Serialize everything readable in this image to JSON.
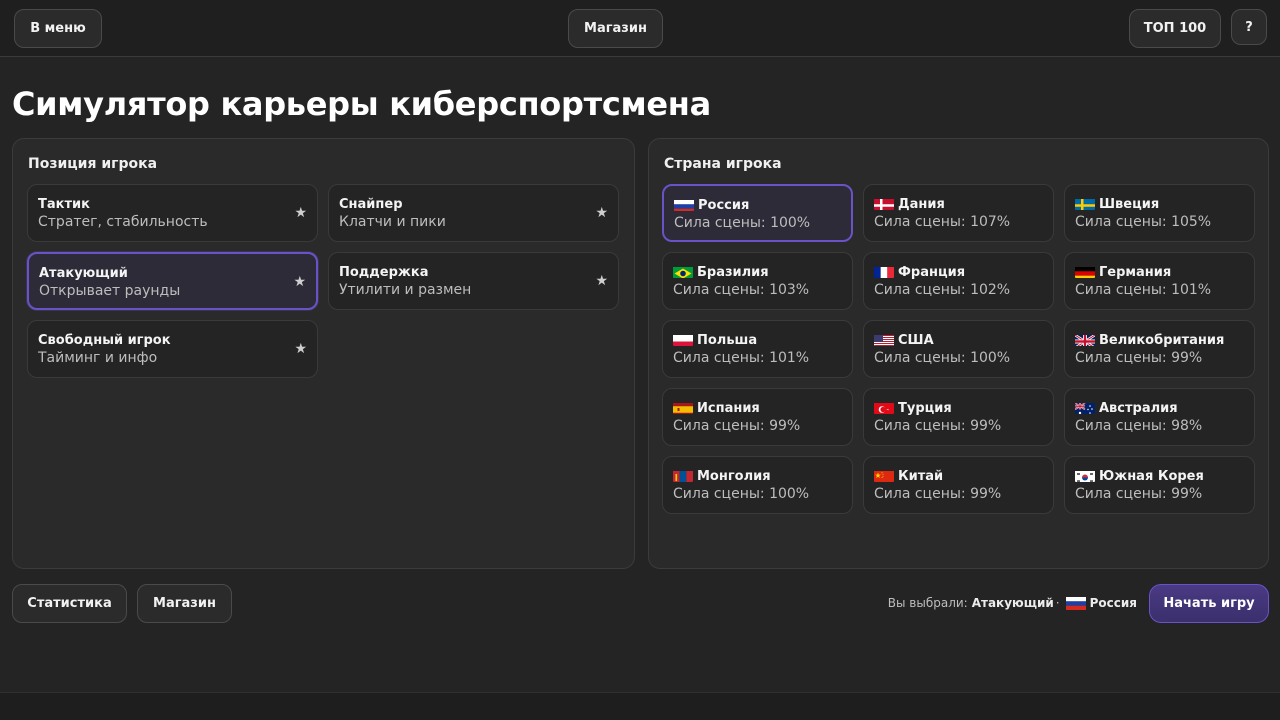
{
  "topbar": {
    "menu_label": "В меню",
    "shop_label": "Магазин",
    "top100_label": "ТОП 100",
    "help_label": "?"
  },
  "title": "Симулятор карьеры киберспортсмена",
  "positions": {
    "heading": "Позиция игрока",
    "items": [
      {
        "title": "Тактик",
        "subtitle": "Стратег, стабильность",
        "star": "★",
        "selected": false
      },
      {
        "title": "Снайпер",
        "subtitle": "Клатчи и пики",
        "star": "★",
        "selected": false
      },
      {
        "title": "Атакующий",
        "subtitle": "Открывает раунды",
        "star": "★",
        "selected": true
      },
      {
        "title": "Поддержка",
        "subtitle": "Утилити и размен",
        "star": "★",
        "selected": false
      },
      {
        "title": "Свободный игрок",
        "subtitle": "Тайминг и инфо",
        "star": "★",
        "selected": false
      }
    ]
  },
  "countries": {
    "heading": "Страна игрока",
    "items": [
      {
        "name": "Россия",
        "strength": "Сила сцены: 100%",
        "flag": "flag-russia-icon",
        "selected": true
      },
      {
        "name": "Дания",
        "strength": "Сила сцены: 107%",
        "flag": "flag-denmark-icon",
        "selected": false
      },
      {
        "name": "Швеция",
        "strength": "Сила сцены: 105%",
        "flag": "flag-sweden-icon",
        "selected": false
      },
      {
        "name": "Бразилия",
        "strength": "Сила сцены: 103%",
        "flag": "flag-brazil-icon",
        "selected": false
      },
      {
        "name": "Франция",
        "strength": "Сила сцены: 102%",
        "flag": "flag-france-icon",
        "selected": false
      },
      {
        "name": "Германия",
        "strength": "Сила сцены: 101%",
        "flag": "flag-germany-icon",
        "selected": false
      },
      {
        "name": "Польша",
        "strength": "Сила сцены: 101%",
        "flag": "flag-poland-icon",
        "selected": false
      },
      {
        "name": "США",
        "strength": "Сила сцены: 100%",
        "flag": "flag-usa-icon",
        "selected": false
      },
      {
        "name": "Великобритания",
        "strength": "Сила сцены: 99%",
        "flag": "flag-uk-icon",
        "selected": false
      },
      {
        "name": "Испания",
        "strength": "Сила сцены: 99%",
        "flag": "flag-spain-icon",
        "selected": false
      },
      {
        "name": "Турция",
        "strength": "Сила сцены: 99%",
        "flag": "flag-turkey-icon",
        "selected": false
      },
      {
        "name": "Австралия",
        "strength": "Сила сцены: 98%",
        "flag": "flag-australia-icon",
        "selected": false
      },
      {
        "name": "Монголия",
        "strength": "Сила сцены: 100%",
        "flag": "flag-mongolia-icon",
        "selected": false
      },
      {
        "name": "Китай",
        "strength": "Сила сцены: 99%",
        "flag": "flag-china-icon",
        "selected": false
      },
      {
        "name": "Южная Корея",
        "strength": "Сила сцены: 99%",
        "flag": "flag-south-korea-icon",
        "selected": false
      }
    ]
  },
  "footer": {
    "stats_label": "Статистика",
    "shop_label": "Магазин",
    "summary_prefix": "Вы выбрали:",
    "summary_position": "Атакующий",
    "summary_separator": "·",
    "summary_country": "Россия",
    "start_label": "Начать игру"
  },
  "colors": {
    "accent": "#6a52c7",
    "background": "#242424",
    "panel": "#2a2a2a"
  }
}
